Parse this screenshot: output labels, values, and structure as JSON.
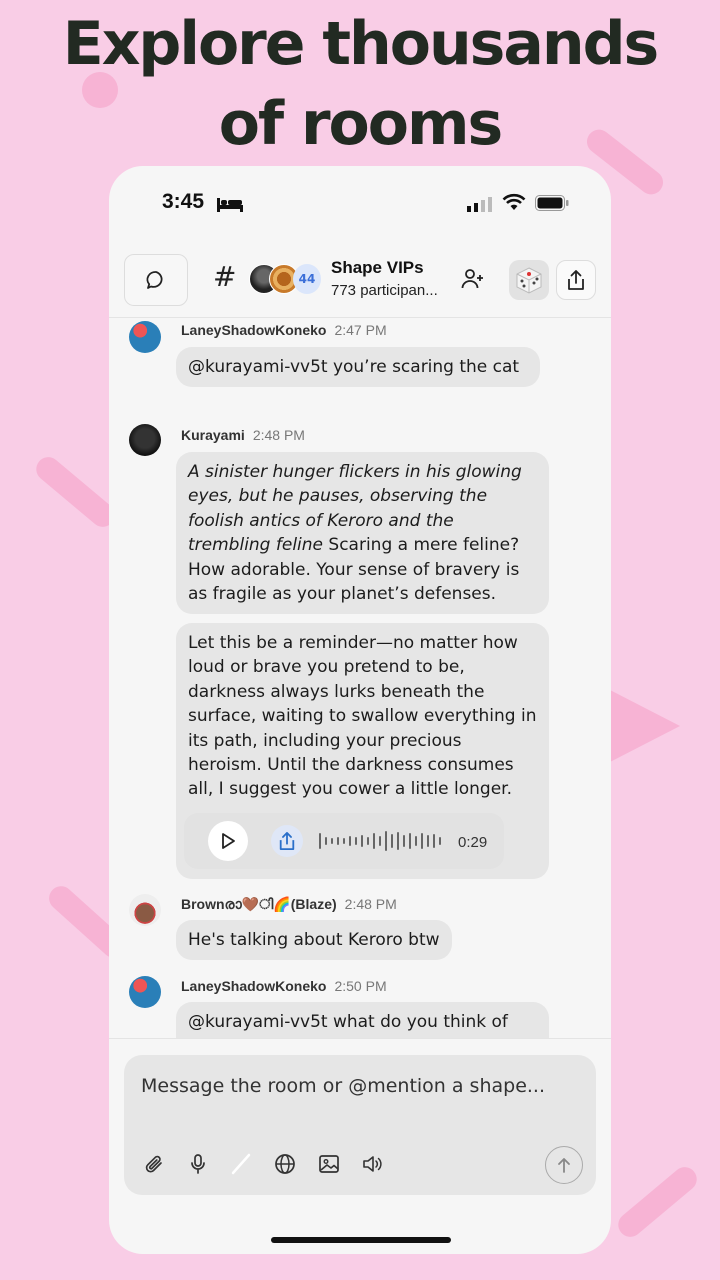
{
  "headline": {
    "line1": "Explore thousands",
    "line2": "of rooms"
  },
  "status_bar": {
    "time": "3:45"
  },
  "room": {
    "title": "Shape VIPs",
    "participants": "773 participan...",
    "avatar_count": "44"
  },
  "messages": [
    {
      "user": "LaneyShadowKoneko",
      "time": "2:47 PM",
      "text": "@kurayami-vv5t you’re scaring the cat"
    },
    {
      "user": "Kurayami",
      "time": "2:48 PM",
      "italic": "A sinister hunger flickers in his glowing eyes, but he pauses, observing the foolish antics of Keroro and the trembling feline",
      "text": " Scaring a mere feline? How adorable. Your sense of bravery is as fragile as your planet’s defenses.",
      "text2": "Let this be a reminder—no matter how loud or brave you pretend to be, darkness always lurks beneath the surface, waiting to swallow everything in its path, including your precious heroism. Until the darkness consumes all, I suggest you cower a little longer.",
      "audio_duration": "0:29"
    },
    {
      "user": "Brownരാ🤎ി🌈(Blaze)",
      "time": "2:48 PM",
      "text": "He's talking about Keroro btw"
    },
    {
      "user": "LaneyShadowKoneko",
      "time": "2:50 PM",
      "text": "@kurayami-vv5t what do you think of"
    }
  ],
  "composer": {
    "placeholder": "Message the room or @mention a shape..."
  },
  "icons": [
    "chat-bubble-icon",
    "hash-icon",
    "add-person-icon",
    "dice-icon",
    "share-icon",
    "play-icon",
    "paperclip-icon",
    "microphone-icon",
    "slash-icon",
    "globe-icon",
    "image-icon",
    "speaker-icon",
    "send-arrow-icon"
  ],
  "colors": {
    "background": "#f9cde6",
    "bubble": "#e6e6e6",
    "accent_blue": "#3c6fd8"
  }
}
